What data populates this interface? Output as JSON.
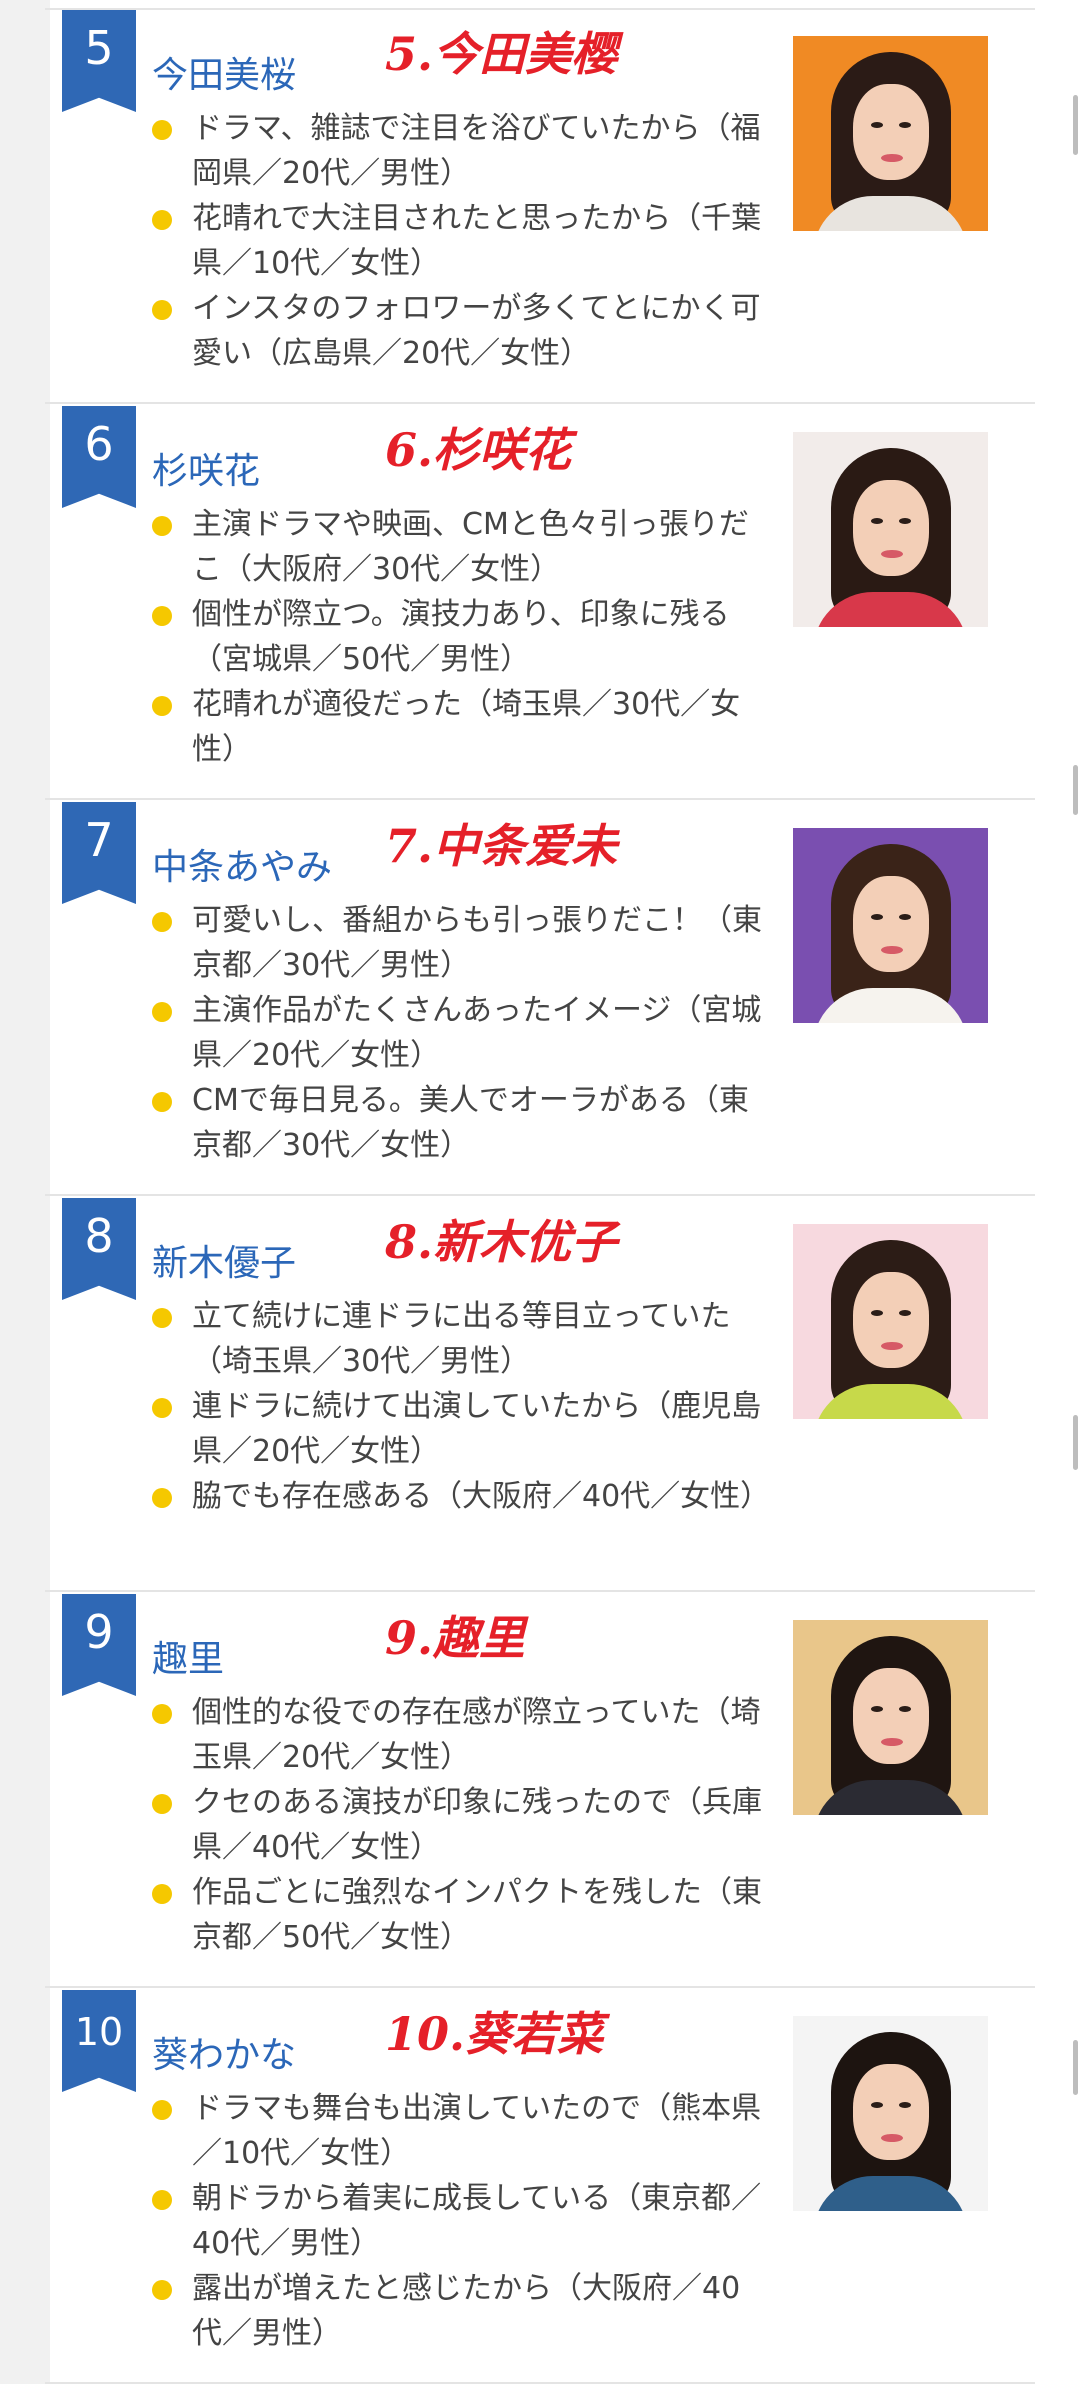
{
  "entries": [
    {
      "rank": "5",
      "name": "今田美桜",
      "handwritten": "5.今田美樱",
      "comments": [
        {
          "text": "ドラマ、雑誌で注目を浴びていたから（福岡県／20代／男性）"
        },
        {
          "text": "花晴れで大注目されたと思ったから（千葉県／10代／女性）"
        },
        {
          "text": "インスタのフォロワーが多くてとにかく可愛い（広島県／20代／女性）"
        }
      ],
      "photo": {
        "bg": "#f08a24",
        "hair": "#2b1b16",
        "top": "#e8e4df"
      }
    },
    {
      "rank": "6",
      "name": "杉咲花",
      "handwritten": "6.杉咲花",
      "comments": [
        {
          "text": "主演ドラマや映画、CMと色々引っ張りだこ（大阪府／30代／女性）"
        },
        {
          "text": "個性が際立つ。演技力あり、印象に残る（宮城県／50代／男性）"
        },
        {
          "text": "花晴れが適役だった（埼玉県／30代／女性）"
        }
      ],
      "photo": {
        "bg": "#f2ecea",
        "hair": "#2a1a14",
        "top": "#d8384a"
      }
    },
    {
      "rank": "7",
      "name": "中条あやみ",
      "handwritten": "7.中条爱未",
      "comments": [
        {
          "text": "可愛いし、番組からも引っ張りだこ！（東京都／30代／男性）"
        },
        {
          "text": "主演作品がたくさんあったイメージ（宮城県／20代／女性）"
        },
        {
          "text": "CMで毎日見る。美人でオーラがある（東京都／30代／女性）"
        }
      ],
      "photo": {
        "bg": "#7a4fb0",
        "hair": "#3a2318",
        "top": "#f6f3ee"
      }
    },
    {
      "rank": "8",
      "name": "新木優子",
      "handwritten": "8.新木优子",
      "comments": [
        {
          "text": "立て続けに連ドラに出る等目立っていた（埼玉県／30代／男性）"
        },
        {
          "text": "連ドラに続けて出演していたから（鹿児島県／20代／女性）"
        },
        {
          "text": "脇でも存在感ある（大阪府／40代／女性）"
        }
      ],
      "photo": {
        "bg": "#f7d9df",
        "hair": "#2c1c16",
        "top": "#c7d94a"
      }
    },
    {
      "rank": "9",
      "name": "趣里",
      "handwritten": "9.趣里",
      "comments": [
        {
          "text": "個性的な役での存在感が際立っていた（埼玉県／20代／女性）"
        },
        {
          "text": "クセのある演技が印象に残ったので（兵庫県／40代／女性）"
        },
        {
          "text": "作品ごとに強烈なインパクトを残した（東京都／50代／女性）"
        }
      ],
      "photo": {
        "bg": "#e9c68a",
        "hair": "#1f1511",
        "top": "#2b2b33"
      }
    },
    {
      "rank": "10",
      "name": "葵わかな",
      "handwritten": "10.葵若菜",
      "comments": [
        {
          "text": "ドラマも舞台も出演していたので（熊本県／10代／女性）"
        },
        {
          "text": "朝ドラから着実に成長している（東京都／40代／男性）"
        },
        {
          "text": "露出が増えたと感じたから（大阪府／40代／男性）"
        }
      ],
      "photo": {
        "bg": "#f4f4f4",
        "hair": "#1d1410",
        "top": "#2f5f8a"
      }
    }
  ]
}
